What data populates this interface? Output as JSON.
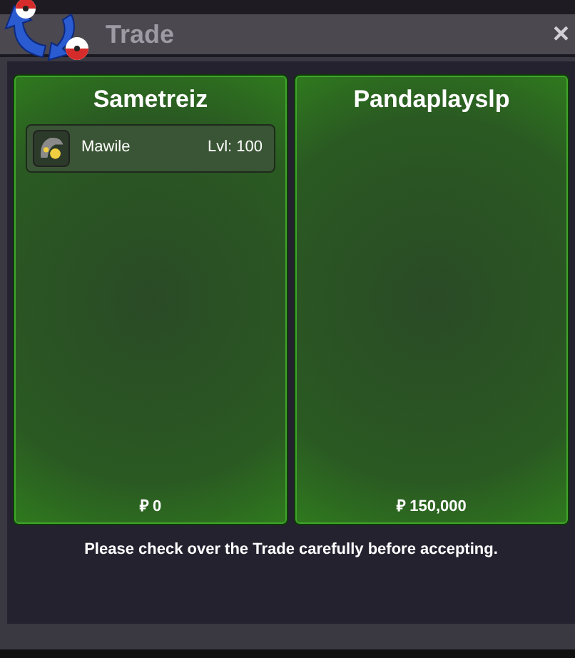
{
  "window": {
    "title": "Trade",
    "close": "×"
  },
  "panels": [
    {
      "trainer": "Sametreiz",
      "items": [
        {
          "name": "Mawile",
          "level": "Lvl: 100"
        }
      ],
      "money": "₽ 0"
    },
    {
      "trainer": "Pandaplayslp",
      "money": "₽ 150,000"
    }
  ],
  "notice": "Please check over the Trade carefully before accepting."
}
